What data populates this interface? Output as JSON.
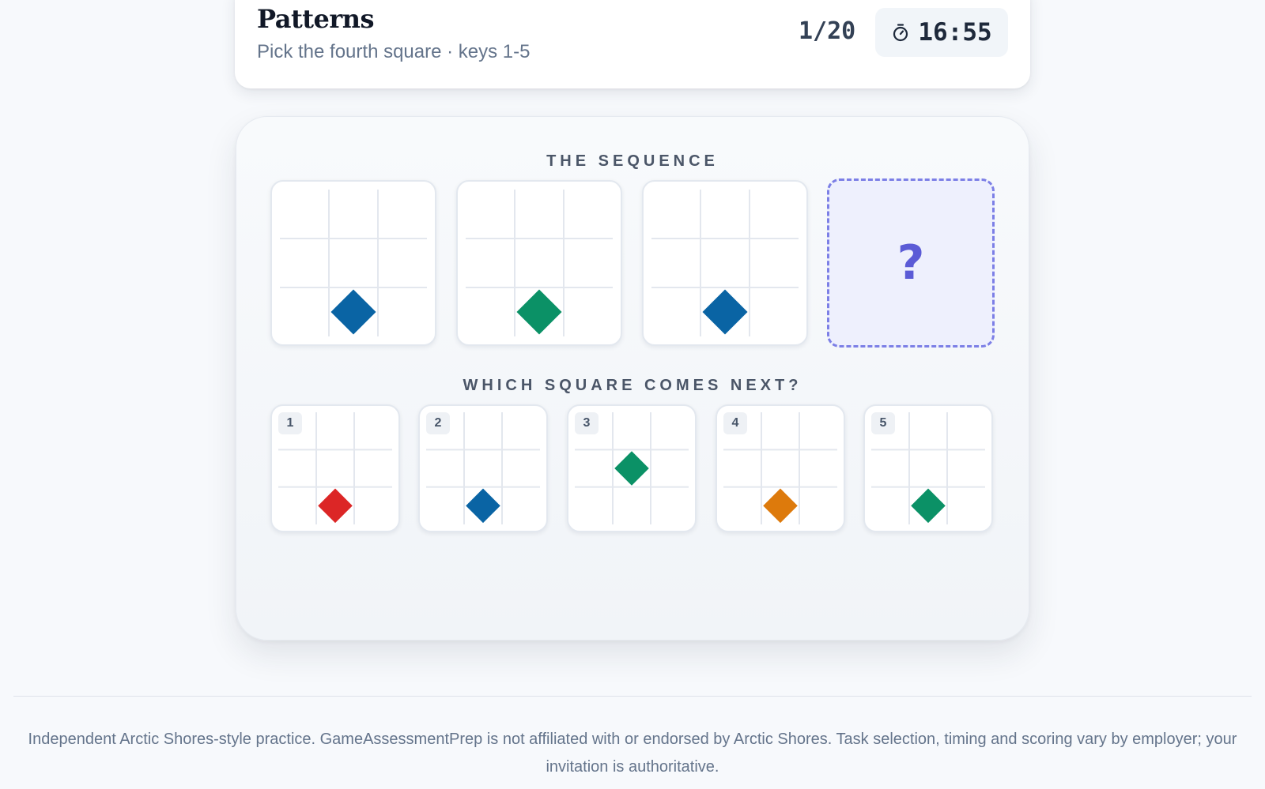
{
  "header": {
    "title": "Patterns",
    "subtitle": "Pick the fourth square · keys 1-5",
    "progress": "1/20",
    "timer": "16:55"
  },
  "puzzle": {
    "sequence_label": "THE SEQUENCE",
    "question_label": "WHICH SQUARE COMES NEXT?",
    "unknown_mark": "?",
    "sequence": [
      {
        "shape": "diamond",
        "row": 3,
        "col": 2,
        "color": "#0a64a4"
      },
      {
        "shape": "diamond",
        "row": 3,
        "col": 2,
        "color": "#0b9166"
      },
      {
        "shape": "diamond",
        "row": 3,
        "col": 2,
        "color": "#0a64a4"
      }
    ],
    "options": [
      {
        "key": "1",
        "shape": "diamond",
        "row": 3,
        "col": 2,
        "color": "#dc2626"
      },
      {
        "key": "2",
        "shape": "diamond",
        "row": 3,
        "col": 2,
        "color": "#0a64a4"
      },
      {
        "key": "3",
        "shape": "diamond",
        "row": 2,
        "col": 2,
        "color": "#0b9166"
      },
      {
        "key": "4",
        "shape": "diamond",
        "row": 3,
        "col": 2,
        "color": "#dd7a0c"
      },
      {
        "key": "5",
        "shape": "diamond",
        "row": 3,
        "col": 2,
        "color": "#0b9166"
      }
    ]
  },
  "footer": {
    "disclaimer": "Independent Arctic Shores-style practice. GameAssessmentPrep is not affiliated with or endorsed by Arctic Shores. Task selection, timing and scoring vary by employer; your invitation is authoritative."
  }
}
